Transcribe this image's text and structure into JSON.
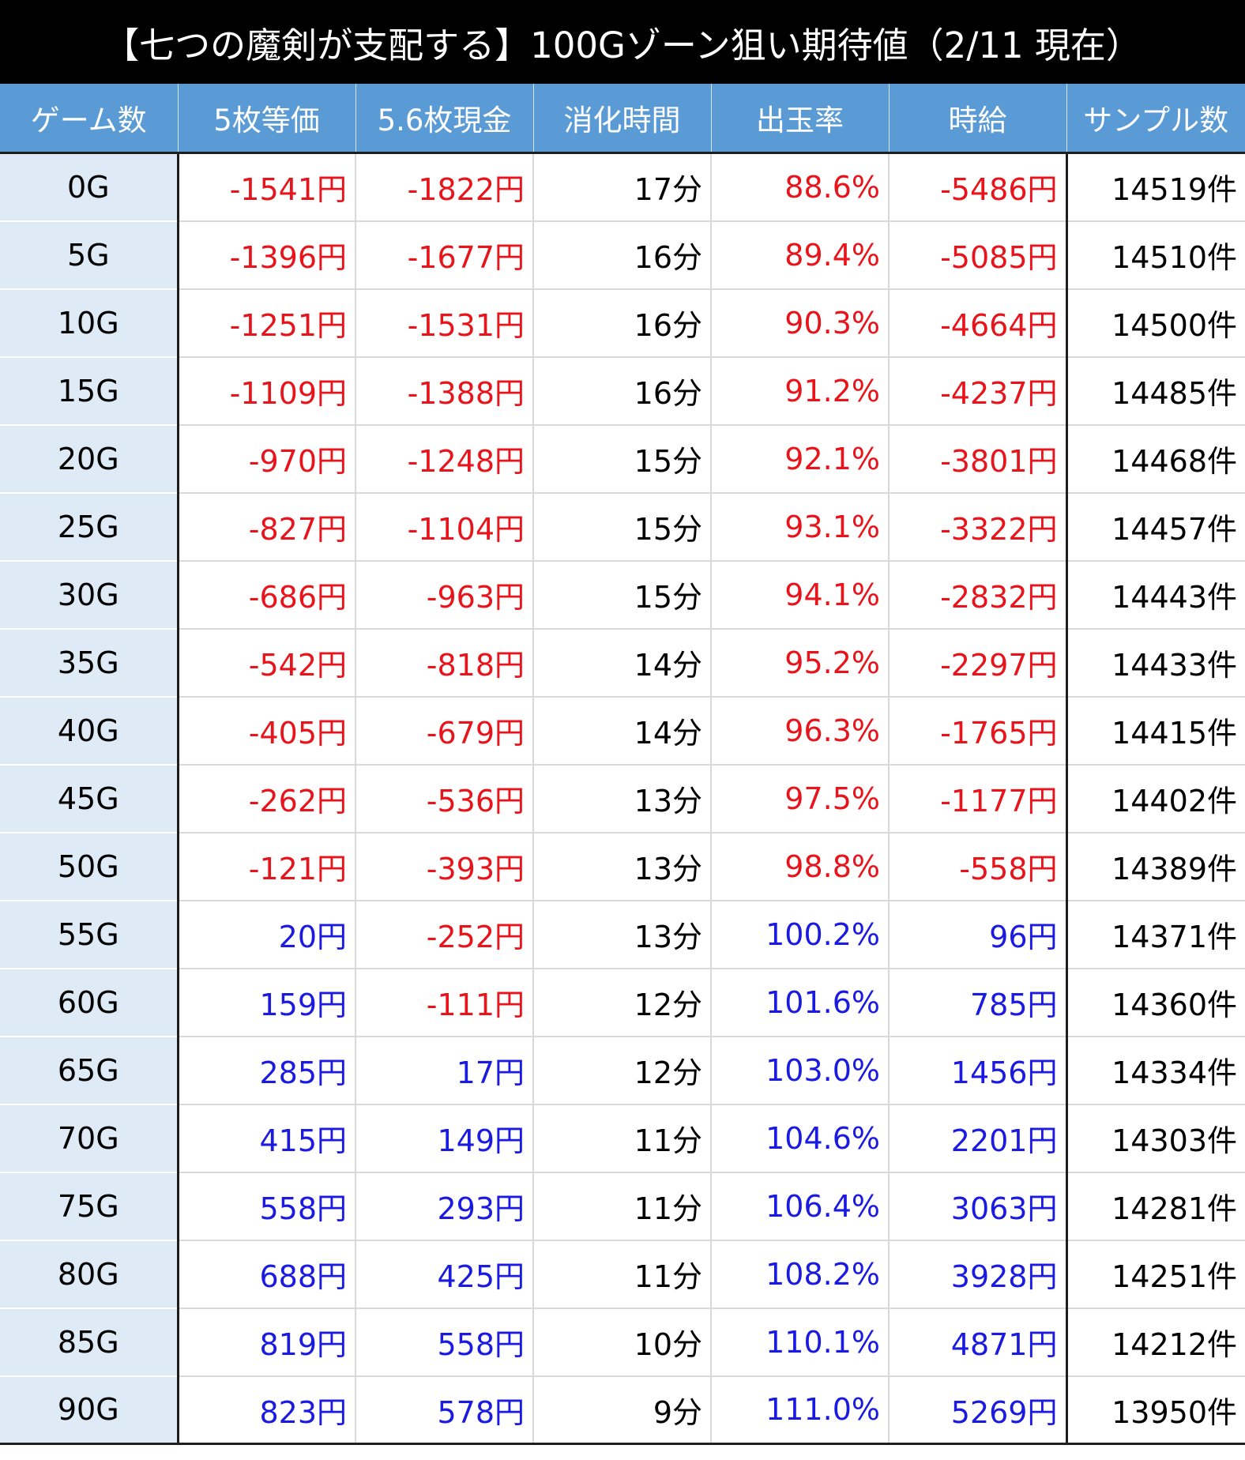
{
  "title": "【七つの魔剣が支配する】100Gゾーン狙い期待値（2/11 現在）",
  "colors": {
    "header_bg": "#5b9bd5",
    "game_col_bg": "#deebf7",
    "negative": "#e8141c",
    "positive": "#1a1ae0"
  },
  "table": {
    "headers": [
      "ゲーム数",
      "5枚等価",
      "5.6枚現金",
      "消化時間",
      "出玉率",
      "時給",
      "サンプル数"
    ],
    "rows": [
      {
        "game": "0G",
        "eq5": "-1541円",
        "cash56": "-1822円",
        "time": "17分",
        "payout": "88.6%",
        "hourly": "-5486円",
        "samples": "14519件"
      },
      {
        "game": "5G",
        "eq5": "-1396円",
        "cash56": "-1677円",
        "time": "16分",
        "payout": "89.4%",
        "hourly": "-5085円",
        "samples": "14510件"
      },
      {
        "game": "10G",
        "eq5": "-1251円",
        "cash56": "-1531円",
        "time": "16分",
        "payout": "90.3%",
        "hourly": "-4664円",
        "samples": "14500件"
      },
      {
        "game": "15G",
        "eq5": "-1109円",
        "cash56": "-1388円",
        "time": "16分",
        "payout": "91.2%",
        "hourly": "-4237円",
        "samples": "14485件"
      },
      {
        "game": "20G",
        "eq5": "-970円",
        "cash56": "-1248円",
        "time": "15分",
        "payout": "92.1%",
        "hourly": "-3801円",
        "samples": "14468件"
      },
      {
        "game": "25G",
        "eq5": "-827円",
        "cash56": "-1104円",
        "time": "15分",
        "payout": "93.1%",
        "hourly": "-3322円",
        "samples": "14457件"
      },
      {
        "game": "30G",
        "eq5": "-686円",
        "cash56": "-963円",
        "time": "15分",
        "payout": "94.1%",
        "hourly": "-2832円",
        "samples": "14443件"
      },
      {
        "game": "35G",
        "eq5": "-542円",
        "cash56": "-818円",
        "time": "14分",
        "payout": "95.2%",
        "hourly": "-2297円",
        "samples": "14433件"
      },
      {
        "game": "40G",
        "eq5": "-405円",
        "cash56": "-679円",
        "time": "14分",
        "payout": "96.3%",
        "hourly": "-1765円",
        "samples": "14415件"
      },
      {
        "game": "45G",
        "eq5": "-262円",
        "cash56": "-536円",
        "time": "13分",
        "payout": "97.5%",
        "hourly": "-1177円",
        "samples": "14402件"
      },
      {
        "game": "50G",
        "eq5": "-121円",
        "cash56": "-393円",
        "time": "13分",
        "payout": "98.8%",
        "hourly": "-558円",
        "samples": "14389件"
      },
      {
        "game": "55G",
        "eq5": "20円",
        "cash56": "-252円",
        "time": "13分",
        "payout": "100.2%",
        "hourly": "96円",
        "samples": "14371件"
      },
      {
        "game": "60G",
        "eq5": "159円",
        "cash56": "-111円",
        "time": "12分",
        "payout": "101.6%",
        "hourly": "785円",
        "samples": "14360件"
      },
      {
        "game": "65G",
        "eq5": "285円",
        "cash56": "17円",
        "time": "12分",
        "payout": "103.0%",
        "hourly": "1456円",
        "samples": "14334件"
      },
      {
        "game": "70G",
        "eq5": "415円",
        "cash56": "149円",
        "time": "11分",
        "payout": "104.6%",
        "hourly": "2201円",
        "samples": "14303件"
      },
      {
        "game": "75G",
        "eq5": "558円",
        "cash56": "293円",
        "time": "11分",
        "payout": "106.4%",
        "hourly": "3063円",
        "samples": "14281件"
      },
      {
        "game": "80G",
        "eq5": "688円",
        "cash56": "425円",
        "time": "11分",
        "payout": "108.2%",
        "hourly": "3928円",
        "samples": "14251件"
      },
      {
        "game": "85G",
        "eq5": "819円",
        "cash56": "558円",
        "time": "10分",
        "payout": "110.1%",
        "hourly": "4871円",
        "samples": "14212件"
      },
      {
        "game": "90G",
        "eq5": "823円",
        "cash56": "578円",
        "time": "9分",
        "payout": "111.0%",
        "hourly": "5269円",
        "samples": "13950件"
      }
    ]
  }
}
